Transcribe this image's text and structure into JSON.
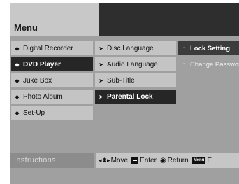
{
  "menu": {
    "title": "Menu"
  },
  "categories": [
    {
      "label": "Digital Recorder",
      "glyph": "◆",
      "selected": false
    },
    {
      "label": "DVD Player",
      "glyph": "◆",
      "selected": true
    },
    {
      "label": "Juke Box",
      "glyph": "◆",
      "selected": false
    },
    {
      "label": "Photo Album",
      "glyph": "◆",
      "selected": false
    },
    {
      "label": "Set-Up",
      "glyph": "◆",
      "selected": false
    }
  ],
  "submenu": [
    {
      "label": "Disc Language",
      "glyph": "➤",
      "selected": false
    },
    {
      "label": "Audio Language",
      "glyph": "➤",
      "selected": false
    },
    {
      "label": "Sub-Title",
      "glyph": "➤",
      "selected": false
    },
    {
      "label": "Parental Lock",
      "glyph": "➤",
      "selected": true
    }
  ],
  "options": [
    {
      "label": "Lock Setting",
      "glyph": "•",
      "active": true
    },
    {
      "label": "Change Password",
      "glyph": "•",
      "active": false
    }
  ],
  "footer": {
    "label": "Instructions",
    "move_icon": "◂⬍▸",
    "move": "Move",
    "enter_icon": "▬",
    "enter": "Enter",
    "return_icon": "◉",
    "return": "Return",
    "menu_icon": "Menu",
    "exit": "E"
  }
}
